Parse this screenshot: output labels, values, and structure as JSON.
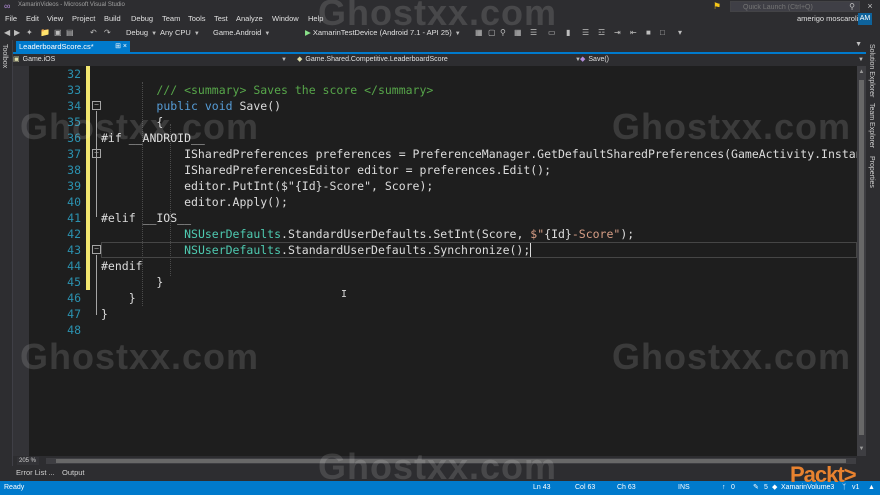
{
  "window": {
    "title": "XamarinVideos - Microsoft Visual Studio",
    "quick_launch_placeholder": "Quick Launch (Ctrl+Q)",
    "user_name": "amerigo moscaroli",
    "user_initials": "AM"
  },
  "menu": [
    "File",
    "Edit",
    "View",
    "Project",
    "Build",
    "Debug",
    "Team",
    "Tools",
    "Test",
    "Analyze",
    "Window",
    "Help"
  ],
  "toolbar": {
    "configuration": "Debug",
    "platform": "Any CPU",
    "startup_project": "Game.Android",
    "device": "XamarinTestDevice (Android 7.1 - API 25)"
  },
  "left_strip": {
    "toolbox": "Toolbox"
  },
  "right_strip": [
    "Solution Explorer",
    "Team Explorer",
    "Properties"
  ],
  "document_tab": {
    "label": "LeaderboardScore.cs*"
  },
  "navbar": {
    "project": "Game.iOS",
    "type": "Game.Shared.Competitive.LeaderboardScore",
    "member": "Save()"
  },
  "editor": {
    "line_numbers": [
      "32",
      "33",
      "34",
      "35",
      "36",
      "37",
      "38",
      "39",
      "40",
      "41",
      "42",
      "43",
      "44",
      "45",
      "46",
      "47",
      "48"
    ],
    "current_line": "43",
    "lines": [
      [],
      [
        {
          "c": "cm",
          "t": "        /// <summary> Saves the score </summary>"
        }
      ],
      [
        {
          "c": "tx",
          "t": "        "
        },
        {
          "c": "kw",
          "t": "public"
        },
        {
          "c": "tx",
          "t": " "
        },
        {
          "c": "kw",
          "t": "void"
        },
        {
          "c": "tx",
          "t": " Save()"
        }
      ],
      [
        {
          "c": "tx",
          "t": "        {"
        }
      ],
      [
        {
          "c": "pl",
          "t": "#if __ANDROID__"
        }
      ],
      [
        {
          "c": "pl",
          "t": "            ISharedPreferences preferences = PreferenceManager.GetDefaultSharedPreferences(GameActivity.Instance"
        }
      ],
      [
        {
          "c": "pl",
          "t": "            ISharedPreferencesEditor editor = preferences.Edit();"
        }
      ],
      [
        {
          "c": "pl",
          "t": "            editor.PutInt($\"{Id}-Score\", Score);"
        }
      ],
      [
        {
          "c": "pl",
          "t": "            editor.Apply();"
        }
      ],
      [
        {
          "c": "pl",
          "t": "#elif __IOS__"
        }
      ],
      [
        {
          "c": "tx",
          "t": "            "
        },
        {
          "c": "ty",
          "t": "NSUserDefaults"
        },
        {
          "c": "tx",
          "t": "."
        },
        {
          "c": "tx",
          "t": "StandardUserDefaults.SetInt(Score, "
        },
        {
          "c": "st",
          "t": "$\""
        },
        {
          "c": "tx",
          "t": "{Id}"
        },
        {
          "c": "st",
          "t": "-Score\""
        },
        {
          "c": "tx",
          "t": ");"
        }
      ],
      [
        {
          "c": "tx",
          "t": "            "
        },
        {
          "c": "ty",
          "t": "NSUserDefaults"
        },
        {
          "c": "tx",
          "t": ".StandardUserDefaults.Synchronize();"
        }
      ],
      [
        {
          "c": "pl",
          "t": "#endif"
        }
      ],
      [
        {
          "c": "tx",
          "t": "        }"
        }
      ],
      [
        {
          "c": "tx",
          "t": "    }"
        }
      ],
      [
        {
          "c": "tx",
          "t": "}"
        }
      ],
      []
    ]
  },
  "zoom": "205 %",
  "bottom_tabs": [
    "Error List ...",
    "Output"
  ],
  "status": {
    "ready": "Ready",
    "line": "Ln 43",
    "col": "Col 63",
    "ch": "Ch 63",
    "ins": "INS",
    "up_count": "0",
    "pencil_count": "5",
    "repo": "XamarinVolume3",
    "branch": "v1"
  },
  "watermark": "Ghostxx.com",
  "brand_mark": "Packt>",
  "colors": {
    "accent": "#007acc",
    "editor_bg": "#1e1e1e",
    "chrome_bg": "#2d2d30",
    "keyword": "#569cd6",
    "comment": "#57a64a",
    "type": "#4ec9b0",
    "string": "#d69d85",
    "line_number": "#2b91af",
    "change_marker": "#f2e66f"
  }
}
